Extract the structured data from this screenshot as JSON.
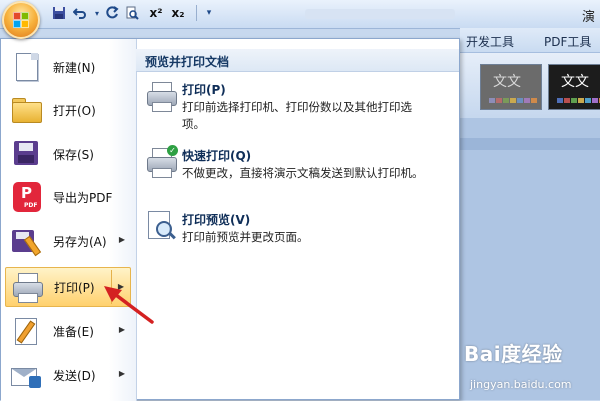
{
  "window": {
    "title_fragment": "演"
  },
  "quick_access": {
    "icons": [
      "save-icon",
      "undo-icon",
      "redo-icon",
      "print-preview-icon",
      "superscript-icon",
      "subscript-icon",
      "customize-icon"
    ],
    "superscript_label": "x²",
    "subscript_label": "x₂"
  },
  "ribbon": {
    "tabs": [
      "开发工具",
      "PDF工具集"
    ],
    "theme_thumbs": [
      {
        "text": "文文",
        "bg": "#6b6b6b",
        "fg": "#d9d9d9"
      },
      {
        "text": "文文",
        "bg": "#1c1c1c",
        "fg": "#ffffff"
      }
    ]
  },
  "office_menu": {
    "left_items": [
      {
        "label": "新建(N)",
        "icon": "new-document-icon",
        "has_arrow": false
      },
      {
        "label": "打开(O)",
        "icon": "open-folder-icon",
        "has_arrow": false
      },
      {
        "label": "保存(S)",
        "icon": "save-icon",
        "has_arrow": false
      },
      {
        "label": "导出为PDF",
        "icon": "pdf-icon",
        "has_arrow": false
      },
      {
        "label": "另存为(A)",
        "icon": "save-as-icon",
        "has_arrow": true
      },
      {
        "label": "打印(P)",
        "icon": "printer-icon",
        "has_arrow": true,
        "active": true
      },
      {
        "label": "准备(E)",
        "icon": "prepare-icon",
        "has_arrow": true
      },
      {
        "label": "发送(D)",
        "icon": "send-icon",
        "has_arrow": true
      }
    ],
    "submenu": {
      "header": "预览并打印文档",
      "items": [
        {
          "title": "打印(P)",
          "desc": "打印前选择打印机、打印份数以及其他打印选项。",
          "icon": "printer-icon"
        },
        {
          "title": "快速打印(Q)",
          "desc": "不做更改，直接将演示文稿发送到默认打印机。",
          "icon": "quick-print-icon"
        },
        {
          "title": "打印预览(V)",
          "desc": "打印前预览并更改页面。",
          "icon": "print-preview-icon"
        }
      ]
    }
  },
  "watermark": {
    "brand": "Bai度经验",
    "url": "jingyan.baidu.com"
  },
  "colors": {
    "accent_active": "#ffd16e",
    "arrow_red": "#d42121",
    "header_text": "#153864"
  }
}
